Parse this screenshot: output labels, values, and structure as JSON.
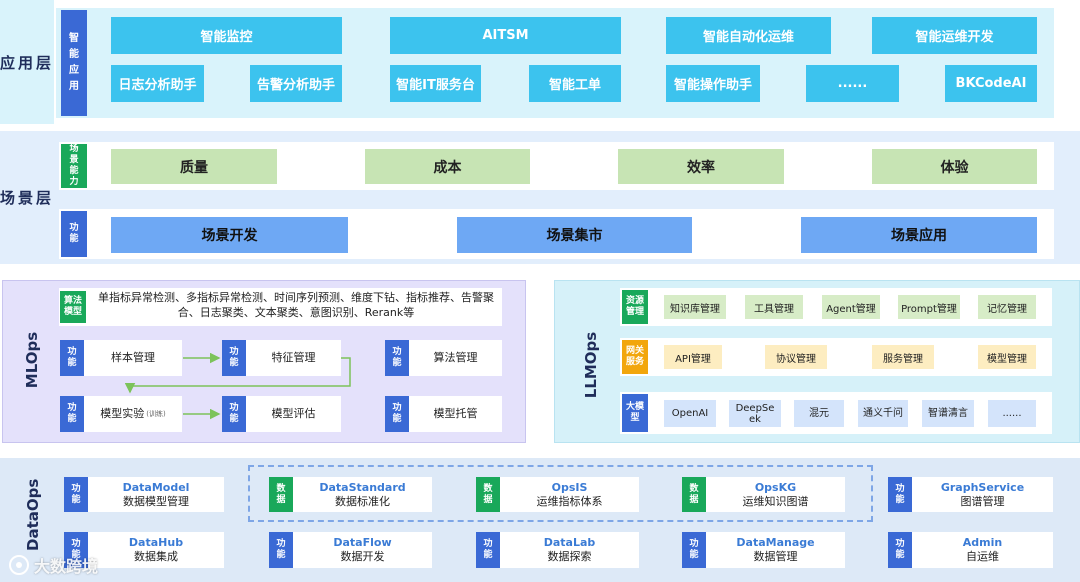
{
  "app_layer": {
    "title": "应用层",
    "tag": "智能应用",
    "row1": [
      "智能监控",
      "AITSM",
      "智能自动化运维",
      "智能运维开发"
    ],
    "row2": [
      "日志分析助手",
      "告警分析助手",
      "智能IT服务台",
      "智能工单",
      "智能操作助手",
      "......",
      "BKCodeAI"
    ]
  },
  "scene_layer": {
    "title": "场景层",
    "cap_tag": "场景能力",
    "capabilities": [
      "质量",
      "成本",
      "效率",
      "体验"
    ],
    "func_tag": "功能",
    "functions": [
      "场景开发",
      "场景集市",
      "场景应用"
    ]
  },
  "mlops": {
    "title": "MLOps",
    "algo_tag": "算法模型",
    "algo_text": "单指标异常检测、多指标异常检测、时间序列预测、维度下钻、指标推荐、告警聚合、日志聚类、文本聚类、意图识别、Rerank等",
    "func_tag": "功能",
    "items": [
      "样本管理",
      "特征管理",
      "算法管理",
      "模型实验",
      "模型评估",
      "模型托管"
    ],
    "train_note": "(训练)"
  },
  "llmops": {
    "title": "LLMOps",
    "resource_tag": "资源管理",
    "resources": [
      "知识库管理",
      "工具管理",
      "Agent管理",
      "Prompt管理",
      "记忆管理"
    ],
    "gateway_tag": "网关服务",
    "gateway": [
      "API管理",
      "协议管理",
      "服务管理",
      "模型管理"
    ],
    "model_tag": "大模型",
    "models": [
      "OpenAI",
      "DeepSeek",
      "混元",
      "通义千问",
      "智谱清言",
      "......"
    ]
  },
  "dataops": {
    "title": "DataOps",
    "func_tag": "功能",
    "data_tag": "数据",
    "row1": [
      {
        "en": "DataModel",
        "cn": "数据模型管理",
        "tag": "功能"
      },
      {
        "en": "DataStandard",
        "cn": "数据标准化",
        "tag": "数据"
      },
      {
        "en": "OpsIS",
        "cn": "运维指标体系",
        "tag": "数据"
      },
      {
        "en": "OpsKG",
        "cn": "运维知识图谱",
        "tag": "数据"
      },
      {
        "en": "GraphService",
        "cn": "图谱管理",
        "tag": "功能"
      }
    ],
    "row2": [
      {
        "en": "DataHub",
        "cn": "数据集成",
        "tag": "功能"
      },
      {
        "en": "DataFlow",
        "cn": "数据开发",
        "tag": "功能"
      },
      {
        "en": "DataLab",
        "cn": "数据探索",
        "tag": "功能"
      },
      {
        "en": "DataManage",
        "cn": "数据管理",
        "tag": "功能"
      },
      {
        "en": "Admin",
        "cn": "自运维",
        "tag": "功能"
      }
    ]
  },
  "watermark": "大数跨境",
  "colors": {
    "app_bg": "#d9f3fb",
    "tag_blue": "#3a69d5",
    "tag_green": "#19a85a",
    "tag_orange": "#f2a60c",
    "cyan": "#3cc3ee"
  }
}
